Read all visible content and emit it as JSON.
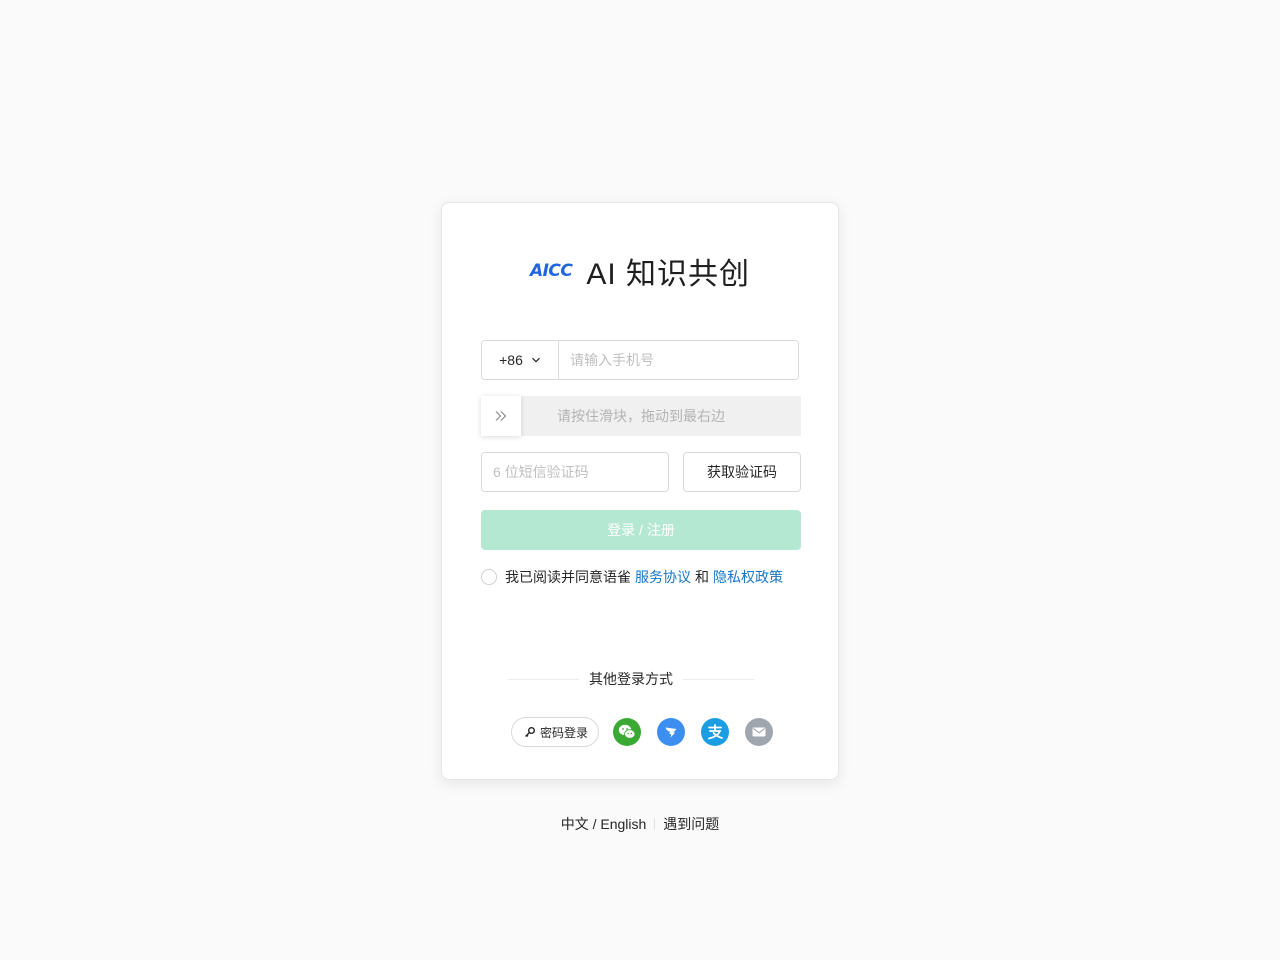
{
  "brand": {
    "logo_text": "AICC",
    "title": "AI 知识共创"
  },
  "phone": {
    "country_code": "+86",
    "placeholder": "请输入手机号",
    "value": ""
  },
  "slider": {
    "hint": "请按住滑块，拖动到最右边"
  },
  "code": {
    "placeholder": "6 位短信验证码",
    "value": "",
    "send_label": "获取验证码"
  },
  "login": {
    "label": "登录 / 注册"
  },
  "agreement": {
    "prefix": "我已阅读并同意语雀",
    "service_link": "服务协议",
    "conjunction": "和",
    "privacy_link": "隐私权政策"
  },
  "other_login": {
    "title": "其他登录方式",
    "password_label": "密码登录",
    "methods": [
      "wechat-icon",
      "dingtalk-icon",
      "alipay-icon",
      "email-icon"
    ]
  },
  "footer": {
    "language": "中文 / English",
    "help": "遇到问题"
  },
  "colors": {
    "accent_link": "#1677c9",
    "login_button_disabled": "#b5e8d3",
    "brand_blue": "#1f64e0",
    "wechat": "#3aaa35",
    "dingtalk": "#3c8ef0",
    "alipay": "#1b9de4",
    "email": "#a0a6ad"
  }
}
